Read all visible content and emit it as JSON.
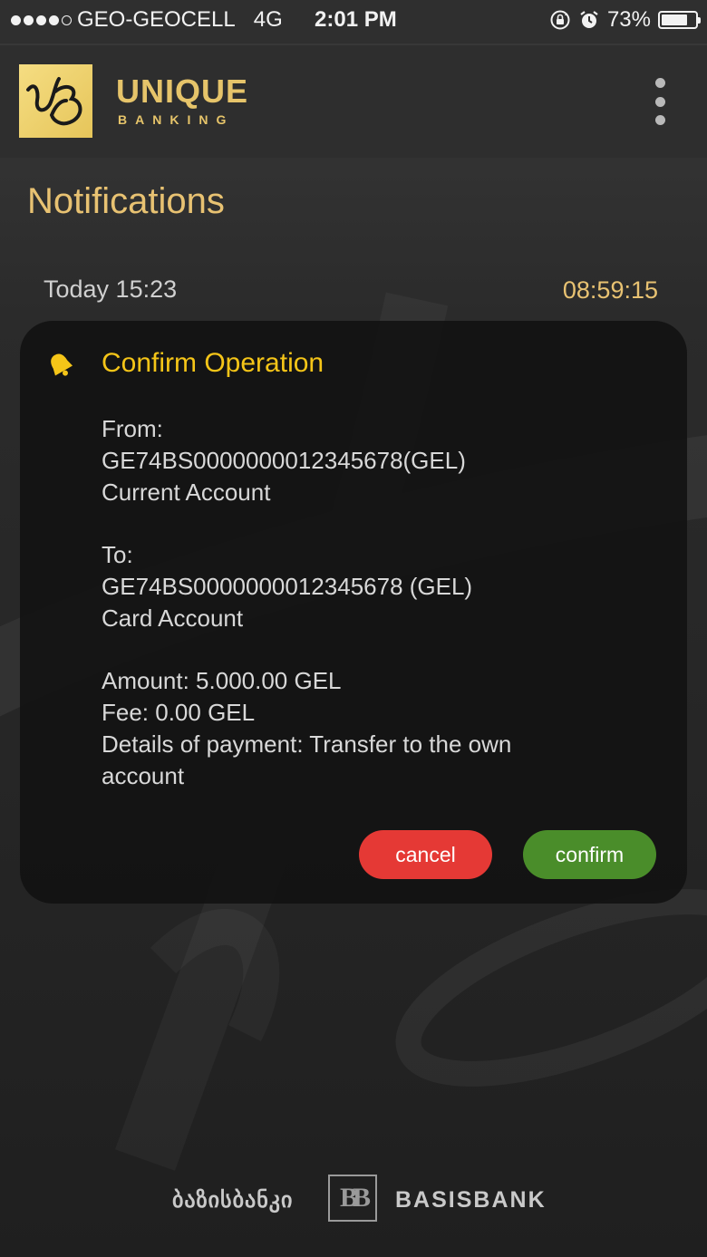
{
  "status_bar": {
    "carrier": "GEO-GEOCELL",
    "network": "4G",
    "time": "2:01 PM",
    "battery": "73%",
    "signal_bars": 4,
    "signal_total": 5
  },
  "header": {
    "brand_line1": "UNIQUE",
    "brand_line2": "BANKING",
    "logo_icon": "ub-monogram-logo",
    "menu_icon": "more-vertical-icon"
  },
  "page": {
    "title": "Notifications"
  },
  "notification": {
    "date": "Today 15:23",
    "timer": "08:59:15",
    "icon": "bell-icon",
    "title": "Confirm Operation",
    "from_label": "From:",
    "from_account": "GE74BS0000000012345678(GEL)",
    "from_type": "Current Account",
    "to_label": "To:",
    "to_account": "GE74BS0000000012345678 (GEL)",
    "to_type": "Card Account",
    "amount": "Amount: 5.000.00 GEL",
    "fee": "Fee: 0.00 GEL",
    "details_line1": "Details of payment: Transfer to the own",
    "details_line2": "account",
    "cancel_label": "cancel",
    "confirm_label": "confirm"
  },
  "footer": {
    "georgian_name": "ბაზისბანკი",
    "logo_text": "BB",
    "bank_name": "BASISBANK"
  },
  "colors": {
    "gold": "#e8c272",
    "title_yellow": "#f5c518",
    "cancel_red": "#e53935",
    "confirm_green": "#4a8d2a"
  }
}
